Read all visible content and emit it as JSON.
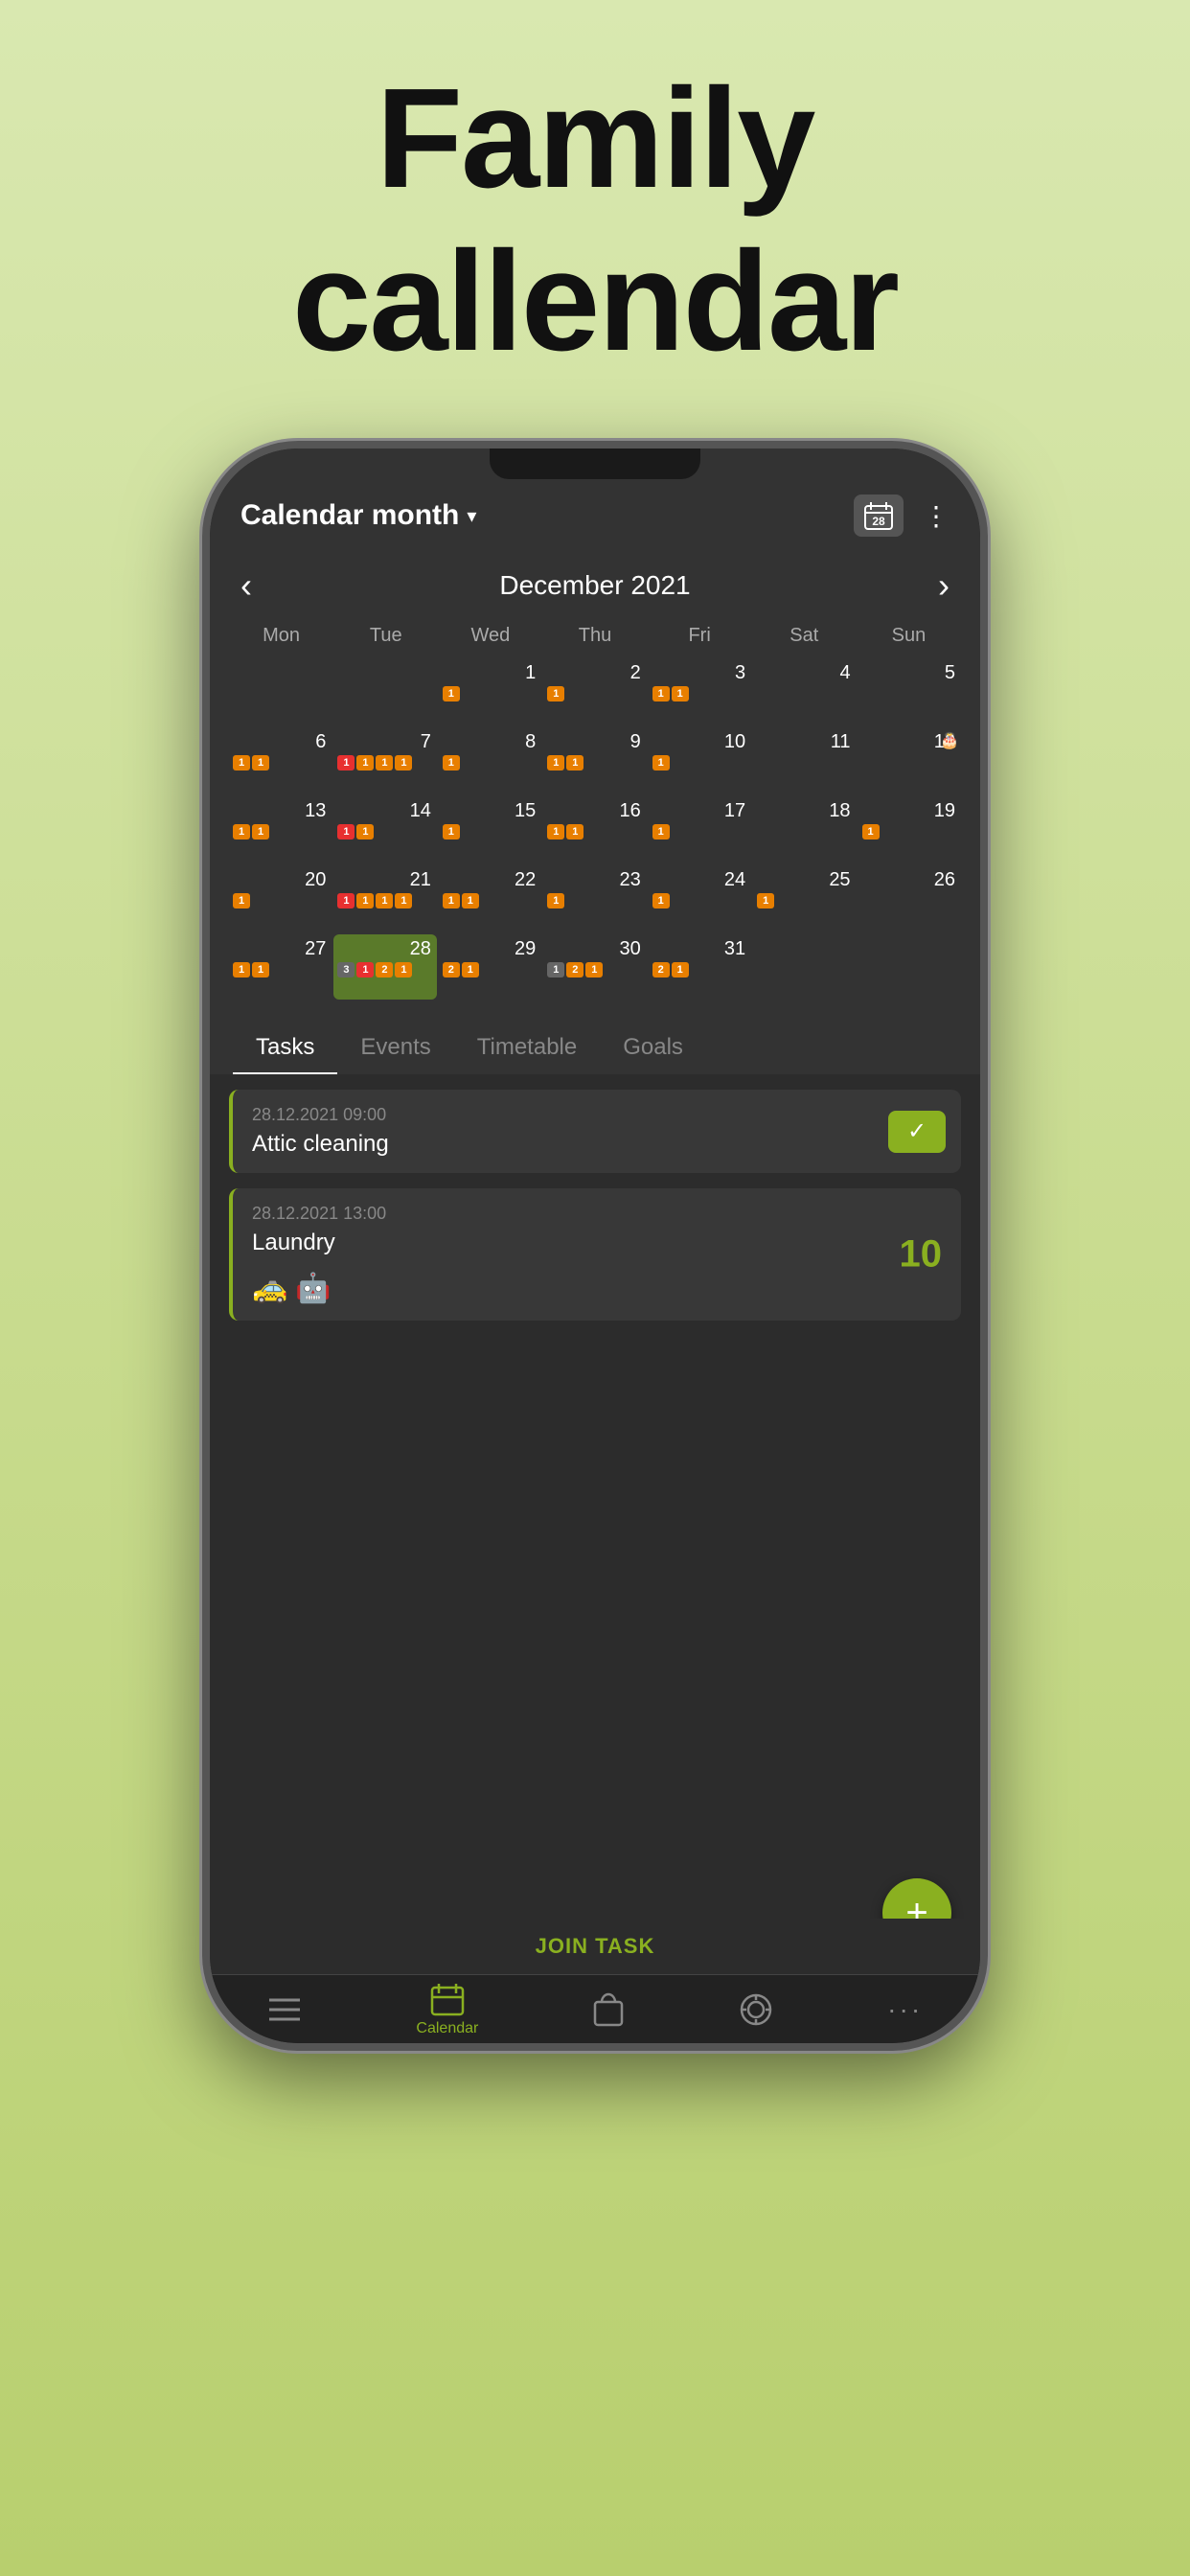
{
  "hero": {
    "line1": "Family",
    "line2": "callendar"
  },
  "header": {
    "title": "Calendar month",
    "calendar_icon": "📅",
    "calendar_day": "28",
    "more_icon": "⋮"
  },
  "calendar": {
    "month_label": "December 2021",
    "day_names": [
      "Mon",
      "Tue",
      "Wed",
      "Thu",
      "Fri",
      "Sat",
      "Sun"
    ],
    "weeks": [
      [
        {
          "num": "",
          "badges": [],
          "gray": false
        },
        {
          "num": "",
          "badges": [],
          "gray": false
        },
        {
          "num": "1",
          "badges": [
            {
              "type": "orange",
              "val": "1"
            }
          ],
          "gray": false
        },
        {
          "num": "2",
          "badges": [
            {
              "type": "orange",
              "val": "1"
            }
          ],
          "gray": false
        },
        {
          "num": "3",
          "badges": [
            {
              "type": "orange",
              "val": "1"
            },
            {
              "type": "orange",
              "val": "1"
            }
          ],
          "gray": false
        },
        {
          "num": "4",
          "badges": [],
          "gray": false
        },
        {
          "num": "5",
          "badges": [],
          "gray": false
        }
      ],
      [
        {
          "num": "6",
          "badges": [
            {
              "type": "orange",
              "val": "1"
            },
            {
              "type": "orange",
              "val": "1"
            }
          ],
          "gray": false
        },
        {
          "num": "7",
          "badges": [
            {
              "type": "red",
              "val": "1"
            },
            {
              "type": "orange",
              "val": "1"
            },
            {
              "type": "orange",
              "val": "1"
            },
            {
              "type": "orange",
              "val": "1"
            }
          ],
          "gray": false
        },
        {
          "num": "8",
          "badges": [
            {
              "type": "orange",
              "val": "1"
            }
          ],
          "gray": false
        },
        {
          "num": "9",
          "badges": [
            {
              "type": "orange",
              "val": "1"
            },
            {
              "type": "orange",
              "val": "1"
            }
          ],
          "gray": false
        },
        {
          "num": "10",
          "badges": [
            {
              "type": "orange",
              "val": "1"
            }
          ],
          "gray": false
        },
        {
          "num": "11",
          "badges": [],
          "gray": false
        },
        {
          "num": "12",
          "badges": [],
          "birthday": true,
          "gray": false
        }
      ],
      [
        {
          "num": "13",
          "badges": [
            {
              "type": "orange",
              "val": "1"
            },
            {
              "type": "orange",
              "val": "1"
            }
          ],
          "gray": false
        },
        {
          "num": "14",
          "badges": [
            {
              "type": "red",
              "val": "1"
            },
            {
              "type": "orange",
              "val": "1"
            }
          ],
          "gray": false
        },
        {
          "num": "15",
          "badges": [
            {
              "type": "orange",
              "val": "1"
            }
          ],
          "gray": false
        },
        {
          "num": "16",
          "badges": [
            {
              "type": "orange",
              "val": "1"
            },
            {
              "type": "orange",
              "val": "1"
            }
          ],
          "gray": false
        },
        {
          "num": "17",
          "badges": [
            {
              "type": "orange",
              "val": "1"
            }
          ],
          "gray": false
        },
        {
          "num": "18",
          "badges": [],
          "gray": false
        },
        {
          "num": "19",
          "badges": [
            {
              "type": "orange",
              "val": "1"
            }
          ],
          "gray": false
        }
      ],
      [
        {
          "num": "20",
          "badges": [
            {
              "type": "orange",
              "val": "1"
            }
          ],
          "gray": false
        },
        {
          "num": "21",
          "badges": [
            {
              "type": "red",
              "val": "1"
            },
            {
              "type": "orange",
              "val": "1"
            },
            {
              "type": "orange",
              "val": "1"
            },
            {
              "type": "orange",
              "val": "1"
            }
          ],
          "gray": false
        },
        {
          "num": "22",
          "badges": [
            {
              "type": "orange",
              "val": "1"
            },
            {
              "type": "orange",
              "val": "1"
            }
          ],
          "gray": false
        },
        {
          "num": "23",
          "badges": [
            {
              "type": "orange",
              "val": "1"
            }
          ],
          "gray": false
        },
        {
          "num": "24",
          "badges": [
            {
              "type": "orange",
              "val": "1"
            }
          ],
          "gray": false
        },
        {
          "num": "25",
          "badges": [
            {
              "type": "orange",
              "val": "1"
            }
          ],
          "gray": false
        },
        {
          "num": "26",
          "badges": [],
          "gray": false
        }
      ],
      [
        {
          "num": "27",
          "badges": [
            {
              "type": "orange",
              "val": "1"
            },
            {
              "type": "orange",
              "val": "1"
            }
          ],
          "gray": false
        },
        {
          "num": "28",
          "badges": [
            {
              "type": "gray",
              "val": "3"
            },
            {
              "type": "red",
              "val": "1"
            },
            {
              "type": "orange",
              "val": "2"
            },
            {
              "type": "orange",
              "val": "1"
            }
          ],
          "selected": true,
          "gray": false
        },
        {
          "num": "29",
          "badges": [
            {
              "type": "orange",
              "val": "2"
            },
            {
              "type": "orange",
              "val": "1"
            }
          ],
          "gray": false
        },
        {
          "num": "30",
          "badges": [
            {
              "type": "gray",
              "val": "1"
            },
            {
              "type": "orange",
              "val": "2"
            },
            {
              "type": "orange",
              "val": "1"
            }
          ],
          "gray": false
        },
        {
          "num": "31",
          "badges": [
            {
              "type": "orange",
              "val": "2"
            },
            {
              "type": "orange",
              "val": "1"
            }
          ],
          "gray": false
        },
        {
          "num": "",
          "badges": [],
          "gray": true
        },
        {
          "num": "",
          "badges": [],
          "gray": true
        }
      ]
    ]
  },
  "tabs": [
    {
      "label": "Tasks",
      "active": true
    },
    {
      "label": "Events",
      "active": false
    },
    {
      "label": "Timetable",
      "active": false
    },
    {
      "label": "Goals",
      "active": false
    }
  ],
  "tasks": [
    {
      "datetime": "28.12.2021 09:00",
      "title": "Attic cleaning",
      "has_check": true,
      "number": null
    },
    {
      "datetime": "28.12.2021 13:00",
      "title": "Laundry",
      "has_check": false,
      "number": "10",
      "emojis": [
        "🚕",
        "🤖"
      ]
    }
  ],
  "fab": "+",
  "join_task": "JOIN TASK",
  "bottom_nav": [
    {
      "icon": "☰",
      "label": "",
      "active": false
    },
    {
      "icon": "📅",
      "label": "Calendar",
      "active": true
    },
    {
      "icon": "🛍",
      "label": "",
      "active": false
    },
    {
      "icon": "⊕",
      "label": "",
      "active": false
    },
    {
      "icon": "•••",
      "label": "",
      "active": false
    }
  ]
}
